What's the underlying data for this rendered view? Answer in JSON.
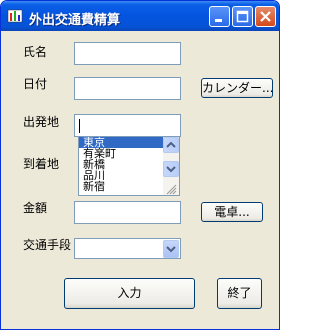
{
  "window": {
    "title": "外出交通費精算"
  },
  "form": {
    "name_label": "氏名",
    "name_value": "",
    "date_label": "日付",
    "date_value": "",
    "calendar_button": "カレンダー...",
    "departure_label": "出発地",
    "departure_value": "",
    "arrival_label": "到着地",
    "amount_label": "金額",
    "amount_value": "",
    "calculator_button": "電卓...",
    "transport_label": "交通手段",
    "transport_value": "",
    "submit_button": "入力",
    "exit_button": "終了"
  },
  "station_list": {
    "items": [
      "東京",
      "有楽町",
      "新橋",
      "品川",
      "新宿"
    ],
    "selected": "東京"
  },
  "colors": {
    "titlebar": "#0554e0",
    "selection": "#316ac5",
    "window_bg": "#ece9d8"
  }
}
